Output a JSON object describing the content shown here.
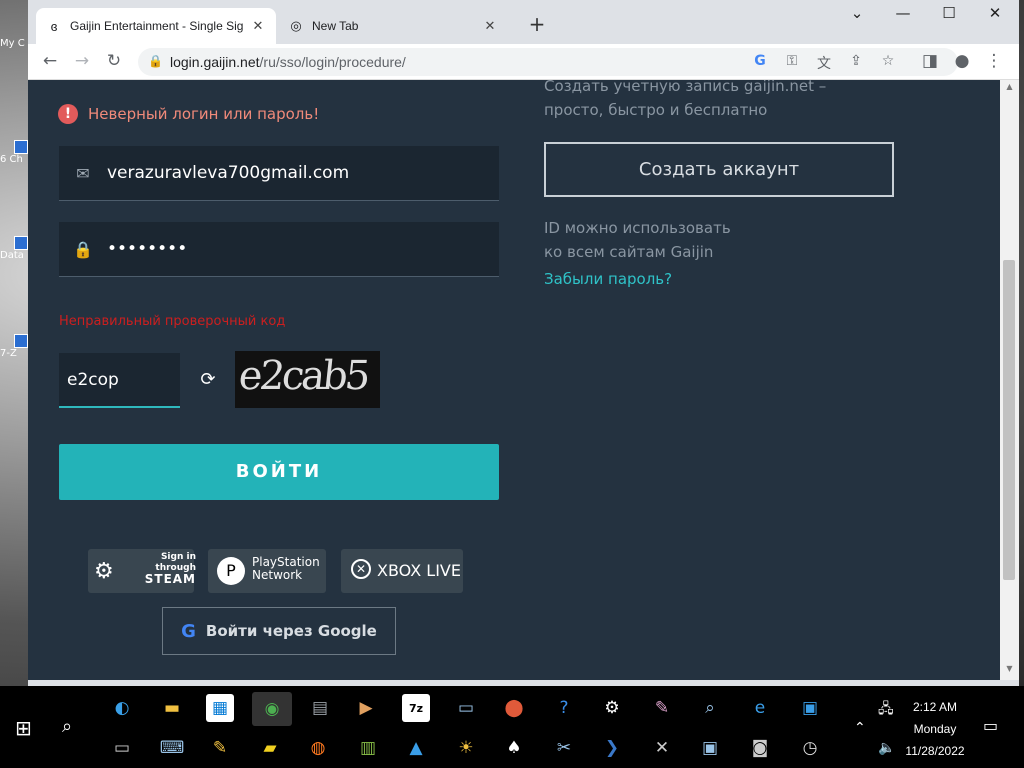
{
  "desktop": {
    "icons": [
      {
        "label": "My C"
      },
      {
        "label": "6 Ch"
      },
      {
        "label": "Data"
      },
      {
        "label": "7-Z"
      }
    ]
  },
  "browser": {
    "tabs": [
      {
        "title": "Gaijin Entertainment - Single Sig",
        "active": true
      },
      {
        "title": "New Tab",
        "active": false
      }
    ],
    "new_tab": "+",
    "url_prefix": "login.gaijin.net",
    "url_path": "/ru/sso/login/procedure/"
  },
  "login": {
    "error_message": "Неверный логин или пароль!",
    "email_value": "verazuravleva700gmail.com",
    "password_value": "••••••••",
    "captcha_error": "Неправильный проверочный код",
    "captcha_value": "e2cop",
    "captcha_image_text": "e2cab5",
    "submit_label": "ВОЙТИ",
    "steam_line1": "Sign in",
    "steam_line2": "through",
    "steam_line3": "STEAM",
    "psn_line1": "PlayStation",
    "psn_line2": "Network",
    "xbox_label": "XBOX LIVE",
    "google_label": "Войти через Google"
  },
  "register": {
    "text_line1": "Создать учетную запись gaijin.net –",
    "text_line2": "просто, быстро и бесплатно",
    "create_label": "Создать аккаунт",
    "id_line1": "ID можно использовать",
    "id_line2": "ко всем сайтам Gaijin",
    "forgot_label": "Забыли пароль?"
  },
  "taskbar": {
    "time": "2:12 AM",
    "day": "Monday",
    "date": "11/28/2022",
    "icon_7z": "7z"
  },
  "colors": {
    "page_bg": "#243240",
    "accent": "#23b3b8",
    "error": "#cc1f1f"
  }
}
